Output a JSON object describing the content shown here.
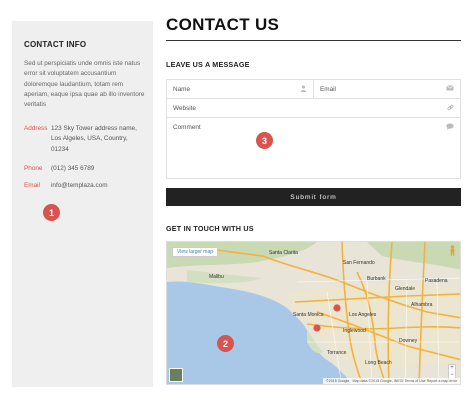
{
  "sidebar": {
    "title": "CONTACT INFO",
    "description": "Sed ut perspiciatis unde omnis iste natus error sit voluptatem accusantium doloremque laudantium, totam rem aperiam, eaque ipsa quae ab illo inventore veritatis",
    "address_label": "Address",
    "address_value": "123 Sky Tower address name, Los Algeles, USA, Country, 01234",
    "phone_label": "Phone",
    "phone_value": "(012) 345 6789",
    "email_label": "Email",
    "email_value": "info@templaza.com",
    "badge": "1"
  },
  "main": {
    "title": "CONTACT US",
    "form_title": "LEAVE US A MESSAGE",
    "name_placeholder": "Name",
    "email_placeholder": "Email",
    "website_placeholder": "Website",
    "comment_placeholder": "Comment",
    "form_badge": "3",
    "submit_label": "Submit form",
    "map_title": "GET IN TOUCH WITH US",
    "map_badge": "2",
    "map_link": "View larger map",
    "map_attribution": "©2015 Google · Map data ©2015 Google, INEGI   Terms of Use   Report a map error",
    "zoom_in": "+",
    "zoom_out": "−",
    "map_labels": [
      "Santa Clarita",
      "San Fernando",
      "Burbank",
      "Glendale",
      "Pasadena",
      "Alhambra",
      "Los Angeles",
      "Santa Monica",
      "Inglewood",
      "Torrance",
      "Long Beach",
      "Downey",
      "Malibu"
    ]
  },
  "icons": {
    "name": "user-icon",
    "email": "envelope-icon",
    "website": "link-icon",
    "comment": "comment-icon"
  },
  "colors": {
    "accent": "#d9534f",
    "submit_bg": "#222222",
    "sidebar_bg": "#efefef",
    "water": "#a9c8e8",
    "land": "#e8e4d8"
  }
}
